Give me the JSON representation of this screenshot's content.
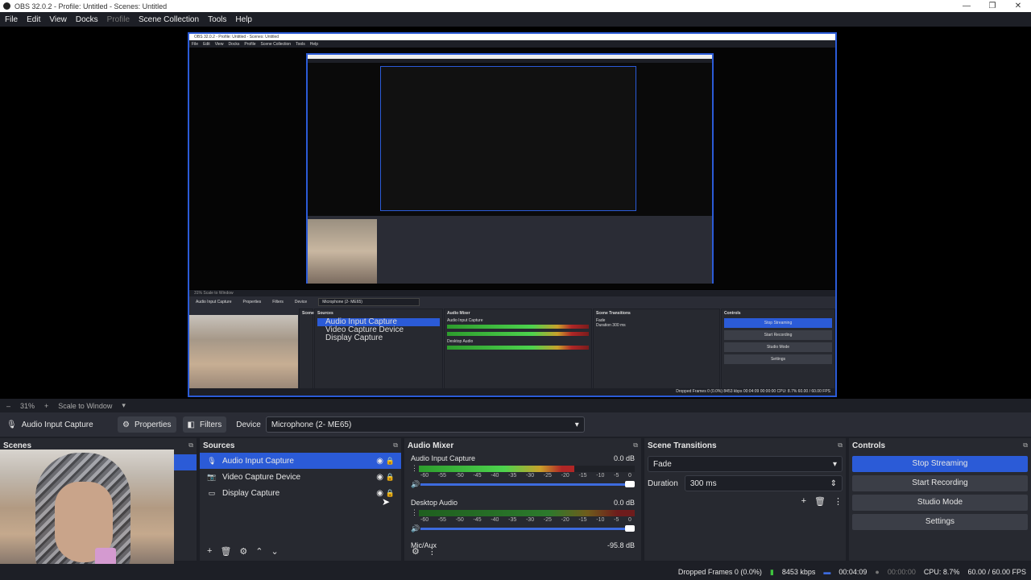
{
  "window": {
    "title": "OBS 32.0.2 - Profile: Untitled - Scenes: Untitled",
    "controls": [
      "—",
      "❐",
      "✕"
    ]
  },
  "menu": {
    "items": [
      "File",
      "Edit",
      "View",
      "Docks",
      "Profile",
      "Scene Collection",
      "Tools",
      "Help"
    ]
  },
  "nested_preview": {
    "title": "OBS 32.0.2 - Profile: Untitled - Scenes: Untitled",
    "menu": [
      "File",
      "Edit",
      "View",
      "Docks",
      "Profile",
      "Scene Collection",
      "Tools",
      "Help"
    ],
    "zoom": "31%   Scale to Window",
    "source_name": "Audio Input Capture",
    "properties": "Properties",
    "filters": "Filters",
    "device_label": "Device",
    "device_value": "Microphone (2- ME65)",
    "scenes_label": "Scenes",
    "sources_label": "Sources",
    "sources": [
      "Audio Input Capture",
      "Video Capture Device",
      "Display Capture"
    ],
    "mixer_label": "Audio Mixer",
    "mixer_ch1": "Audio Input Capture",
    "mixer_ch2": "Desktop Audio",
    "transitions_label": "Scene Transitions",
    "transition": "Fade",
    "duration": "Duration  300 ms",
    "controls_label": "Controls",
    "controls": [
      "Stop Streaming",
      "Start Recording",
      "Studio Mode",
      "Settings"
    ],
    "status": "Dropped Frames 0 (0.0%)   8453 kbps   00:04:09   00:00:00   CPU: 8.7%   60.00 / 60.00 FPS"
  },
  "control_bar": {
    "zoom": "31%",
    "scale": "Scale to Window"
  },
  "properties_bar": {
    "source_name": "Audio Input Capture",
    "properties": "Properties",
    "filters": "Filters",
    "device_label": "Device",
    "device_value": "Microphone (2- ME65)"
  },
  "scenes": {
    "title": "Scenes"
  },
  "sources": {
    "title": "Sources",
    "items": [
      {
        "label": "Audio Input Capture",
        "icon": "microphone-icon",
        "selected": true
      },
      {
        "label": "Video Capture Device",
        "icon": "camera-icon",
        "selected": false
      },
      {
        "label": "Display Capture",
        "icon": "monitor-icon",
        "selected": false
      }
    ]
  },
  "mixer": {
    "title": "Audio Mixer",
    "channels": [
      {
        "name": "Audio Input Capture",
        "db": "0.0 dB",
        "level": 0.72
      },
      {
        "name": "Desktop Audio",
        "db": "0.0 dB",
        "level": 0.0
      }
    ],
    "scale": [
      "-60",
      "-55",
      "-50",
      "-45",
      "-40",
      "-35",
      "-30",
      "-25",
      "-20",
      "-15",
      "-10",
      "-5",
      "0"
    ],
    "third_channel": "Mic/Aux",
    "third_db": "-95.8 dB"
  },
  "transitions": {
    "title": "Scene Transitions",
    "transition": "Fade",
    "duration_label": "Duration",
    "duration_value": "300 ms"
  },
  "controls": {
    "title": "Controls",
    "stop_streaming": "Stop Streaming",
    "start_recording": "Start Recording",
    "studio_mode": "Studio Mode",
    "settings": "Settings"
  },
  "status": {
    "dropped": "Dropped Frames 0 (0.0%)",
    "kbps": "8453 kbps",
    "stream_time": "00:04:09",
    "rec_time": "00:00:00",
    "cpu": "CPU: 8.7%",
    "fps": "60.00 / 60.00 FPS"
  },
  "colors": {
    "accent": "#2b5bd7",
    "background": "#1d1f26",
    "panel": "#272930"
  }
}
